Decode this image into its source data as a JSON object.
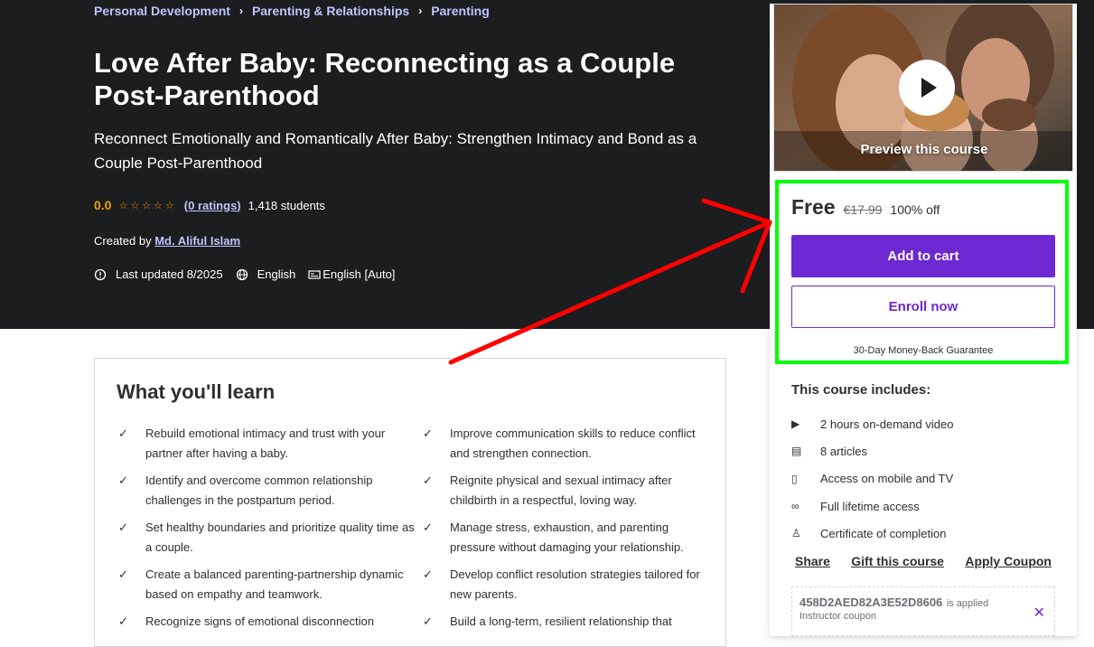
{
  "breadcrumb": [
    "Personal Development",
    "Parenting & Relationships",
    "Parenting"
  ],
  "course": {
    "title": "Love After Baby: Reconnecting as a Couple Post-Parenthood",
    "subtitle": "Reconnect Emotionally and Romantically After Baby: Strengthen Intimacy and Bond as a Couple Post-Parenthood",
    "rating": "0.0",
    "stars": "☆☆☆☆☆",
    "ratings_link": "(0 ratings)",
    "students": "1,418 students",
    "created_by_label": "Created by",
    "instructor": "Md. Aliful Islam",
    "last_updated": "Last updated 8/2025",
    "language": "English",
    "captions": "English [Auto]"
  },
  "learn": {
    "title": "What you'll learn",
    "items": [
      "Rebuild emotional intimacy and trust with your partner after having a baby.",
      "Improve communication skills to reduce conflict and strengthen connection.",
      "Identify and overcome common relationship challenges in the postpartum period.",
      "Reignite physical and sexual intimacy after childbirth in a respectful, loving way.",
      "Set healthy boundaries and prioritize quality time as a couple.",
      "Manage stress, exhaustion, and parenting pressure without damaging your relationship.",
      "Create a balanced parenting-partnership dynamic based on empathy and teamwork.",
      "Develop conflict resolution strategies tailored for new parents.",
      "Recognize signs of emotional disconnection",
      "Build a long-term, resilient relationship that"
    ]
  },
  "sidebar": {
    "preview_label": "Preview this course",
    "price": "Free",
    "original_price": "€17.99",
    "discount": "100% off",
    "add_to_cart": "Add to cart",
    "enroll_now": "Enroll now",
    "guarantee": "30-Day Money-Back Guarantee",
    "includes_title": "This course includes:",
    "includes": [
      {
        "icon": "video-icon",
        "glyph": "▶",
        "text": "2 hours on-demand video"
      },
      {
        "icon": "article-icon",
        "glyph": "▤",
        "text": "8 articles"
      },
      {
        "icon": "mobile-icon",
        "glyph": "▯",
        "text": "Access on mobile and TV"
      },
      {
        "icon": "infinity-icon",
        "glyph": "∞",
        "text": "Full lifetime access"
      },
      {
        "icon": "trophy-icon",
        "glyph": "♙",
        "text": "Certificate of completion"
      }
    ],
    "share": "Share",
    "gift": "Gift this course",
    "apply_coupon": "Apply Coupon",
    "coupon_code": "458D2AED82A3E52D8606",
    "coupon_note": "is applied",
    "coupon_sub": "Instructor coupon"
  },
  "colors": {
    "accent": "#6d28d2",
    "highlight": "#00ff00",
    "annotation_arrow": "#ff0000",
    "hero_bg": "#1c1d1f",
    "rating": "#f69c08"
  }
}
